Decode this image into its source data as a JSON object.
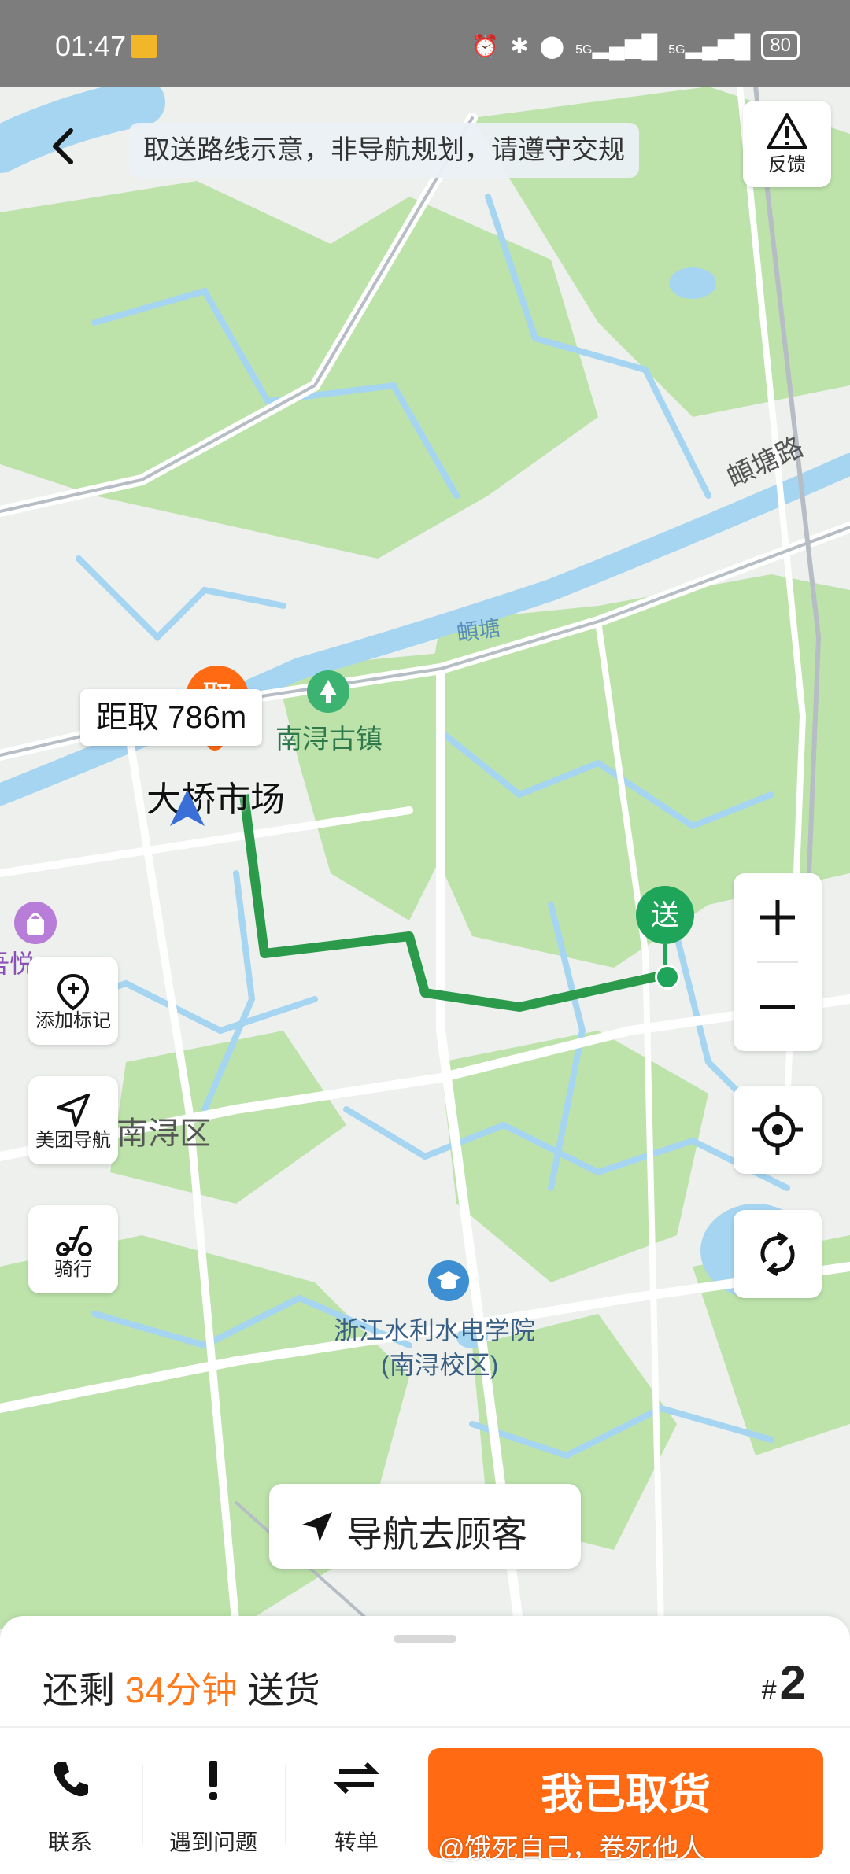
{
  "status_bar": {
    "time": "01:47",
    "signal_1": "5G",
    "signal_2": "5G",
    "battery": "80"
  },
  "header": {
    "notice": "取送路线示意，非导航规划，请遵守交规",
    "feedback_label": "反馈"
  },
  "map": {
    "road_label": "頔塘路",
    "water_label": "頔塘",
    "pickup_marker": "取",
    "distance_label": "距取 786m",
    "pickup_place": "大桥市场",
    "poi_town": "南浔古镇",
    "district": "南浔区",
    "partial_poi": "吾悦",
    "college_line1": "浙江水利水电学院",
    "college_line2": "(南浔校区)",
    "delivery_marker": "送"
  },
  "tools": {
    "add_marker": "添加标记",
    "meituan_nav": "美团导航",
    "riding": "骑行"
  },
  "nav_customer_label": "导航去顾客",
  "panel": {
    "remain_prefix": "还剩",
    "remain_time": "34分钟",
    "remain_suffix": "送货",
    "order_hash": "#",
    "order_number": "2",
    "contact": "联系",
    "problem": "遇到问题",
    "transfer": "转单",
    "picked_up": "我已取货"
  },
  "credit_overlay": "@饿死自己，卷死他人",
  "colors": {
    "accent": "#ff6a12",
    "route": "#2b9a4b",
    "water": "#a6d5f2",
    "green_area": "#b9e3a8"
  }
}
